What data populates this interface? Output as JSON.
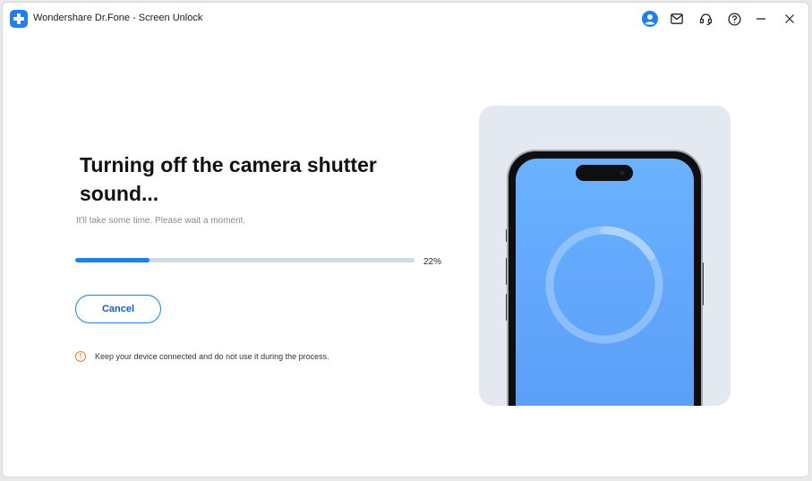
{
  "app": {
    "title": "Wondershare Dr.Fone - Screen Unlock"
  },
  "titlebar_icons": [
    "account-icon",
    "mail-icon",
    "headset-icon",
    "help-icon",
    "minimize-icon",
    "close-icon"
  ],
  "main": {
    "heading": "Turning off the camera shutter sound...",
    "subtext": "It'll take some time. Please wait a moment.",
    "progress": {
      "value": 0.22,
      "label": "22%"
    },
    "cancel_label": "Cancel",
    "warning": "Keep your device connected and do not use it during the process."
  },
  "colors": {
    "accent": "#1f7ef0",
    "warning": "#f07a2a",
    "screen_top": "#6ab2ff",
    "screen_bottom": "#5a9cf8",
    "illustration_bg": "#e4e8f0"
  }
}
